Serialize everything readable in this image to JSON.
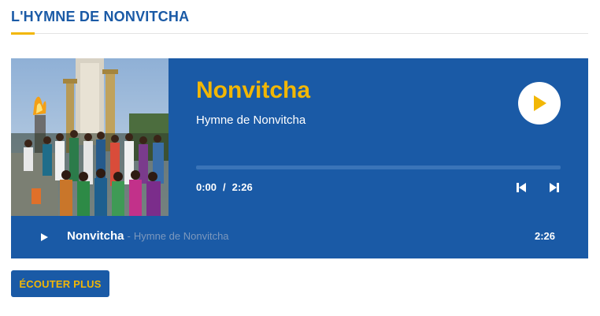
{
  "section": {
    "title": "L'HYMNE DE NONVITCHA"
  },
  "player": {
    "track_name": "Nonvitcha",
    "track_artist": "Hymne de Nonvitcha",
    "current_time": "0:00",
    "time_separator": "/",
    "duration": "2:26",
    "progress": 0,
    "colors": {
      "background": "#1a5aa6",
      "accent": "#f2b705",
      "text": "#ffffff"
    },
    "icons": {
      "play": "play-icon",
      "previous": "skip-previous-icon",
      "next": "skip-next-icon"
    }
  },
  "playlist": [
    {
      "title": "Nonvitcha",
      "separator": "-",
      "artist": "Hymne de Nonvitcha",
      "duration": "2:26"
    }
  ],
  "buttons": {
    "more_label": "ÉCOUTER PLUS"
  }
}
